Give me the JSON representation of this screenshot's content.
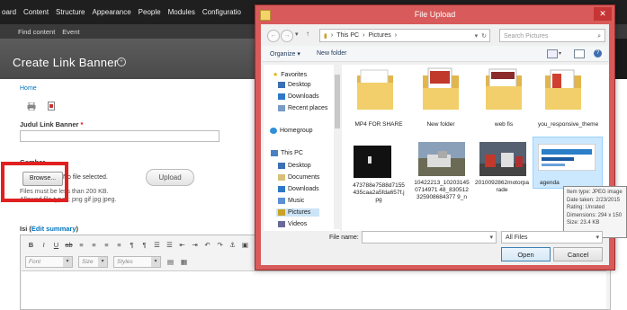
{
  "admin_menu": {
    "items": [
      "oard",
      "Content",
      "Structure",
      "Appearance",
      "People",
      "Modules",
      "Configuratio"
    ]
  },
  "shortcuts": {
    "items": [
      "Find content",
      "Event"
    ]
  },
  "page": {
    "title": "Create Link Banner",
    "breadcrumb": "Home",
    "icons": [
      "print-icon",
      "pdf-icon"
    ],
    "judul_label": "Judul Link Banner",
    "required_mark": "*",
    "gambar_label": "Gambar",
    "browse_label": "Browse...",
    "no_file": "No file selected.",
    "upload_label": "Upload",
    "size_note": "Files must be less than 200 KB.",
    "type_note": "Allowed file types: png gif jpg jpeg.",
    "isi_label": "Isi (",
    "isi_link": "Edit summary",
    "isi_close": ")",
    "editor_font": "Font",
    "editor_size": "Size",
    "editor_styles": "Styles"
  },
  "dialog": {
    "title": "File Upload",
    "address": [
      "This PC",
      "Pictures"
    ],
    "search_placeholder": "Search Pictures",
    "organize": "Organize ▾",
    "new_folder": "New folder",
    "nav_items": [
      {
        "label": "Favorites",
        "icon": "star-icon"
      },
      {
        "label": "Desktop",
        "icon": "desktop-icon"
      },
      {
        "label": "Downloads",
        "icon": "downloads-icon"
      },
      {
        "label": "Recent places",
        "icon": "recent-icon"
      },
      {
        "label": "Homegroup",
        "icon": "homegroup-icon"
      },
      {
        "label": "This PC",
        "icon": "pc-icon"
      },
      {
        "label": "Desktop",
        "icon": "desktop-icon"
      },
      {
        "label": "Documents",
        "icon": "documents-icon"
      },
      {
        "label": "Downloads",
        "icon": "downloads-icon"
      },
      {
        "label": "Music",
        "icon": "music-icon"
      },
      {
        "label": "Pictures",
        "icon": "pictures-icon"
      },
      {
        "label": "Videos",
        "icon": "videos-icon"
      }
    ],
    "files": [
      {
        "name": "MP4 FOR SHARE",
        "type": "folder"
      },
      {
        "name": "New folder",
        "type": "folder"
      },
      {
        "name": "web fis",
        "type": "folder"
      },
      {
        "name": "you_responsive_theme",
        "type": "folder"
      },
      {
        "name": "473788e7588d7155435caa2a5fda657f.jpg",
        "type": "image"
      },
      {
        "name": "10422213_102031450714971 48_830512325908684377 9_n",
        "type": "image"
      },
      {
        "name": "2010092862motorparade",
        "type": "image"
      },
      {
        "name": "agenda",
        "type": "image"
      }
    ],
    "tooltip": [
      "Item type: JPEG image",
      "Date taken: 2/23/2015",
      "Rating: Unrated",
      "Dimensions: 294 x 150",
      "Size: 23.4 KB"
    ],
    "filename_label": "File name:",
    "filetype": "All Files",
    "open_label": "Open",
    "cancel_label": "Cancel"
  },
  "colors": {
    "dialog_frame": "#d85a5a",
    "highlight_box": "#e02020",
    "link": "#0074bd"
  }
}
